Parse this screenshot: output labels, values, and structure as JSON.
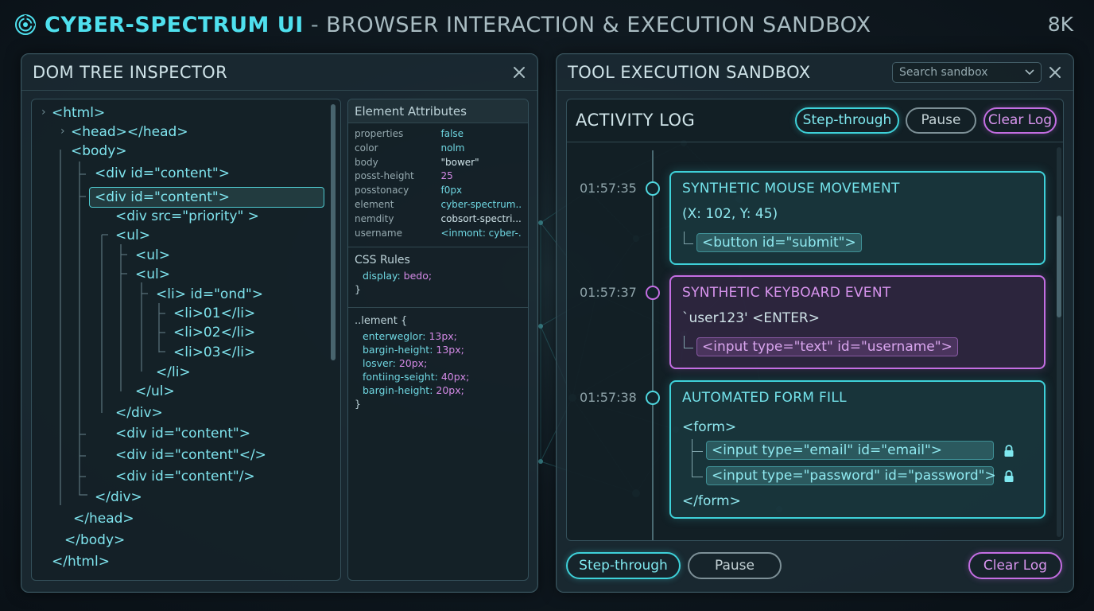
{
  "header": {
    "brand": "CYBER-SPECTRUM UI",
    "separator": " - ",
    "subtitle": "BROWSER INTERACTION & EXECUTION SANDBOX",
    "resolution": "8K"
  },
  "dom_panel": {
    "title": "DOM TREE INSPECTOR",
    "tree": [
      "<html>",
      "<head></head>",
      "<body>",
      "<div id=\"content\">",
      "<div id=\"content\">",
      "<div src=\"priority\" >",
      "<ul>",
      "<ul>",
      "<ul>",
      "<li> id=\"ond\">",
      "<li>01</li>",
      "<li>02</li>",
      "<li>03</li>",
      "</li>",
      "</ul>",
      "</div>",
      "<div id=\"content\">",
      "<div id=\"content\"</>",
      "<div id=\"content\"/>",
      "</div>",
      "</head>",
      "</body>",
      "</html>"
    ],
    "attributes": {
      "title": "Element Attributes",
      "rows": [
        {
          "key": "properties",
          "value": "false"
        },
        {
          "key": "color",
          "value": "nolm"
        },
        {
          "key": "body",
          "value": "\"bower\""
        },
        {
          "key": "posst-height",
          "value": "25"
        },
        {
          "key": "posstonacy",
          "value": "f0px"
        },
        {
          "key": "element",
          "value": "cyber-spectrum..."
        },
        {
          "key": "nemdity",
          "value": "cobsort-spectri..."
        },
        {
          "key": "username",
          "value": "<inmont: cyber-..."
        }
      ]
    },
    "css_rules": {
      "title": "CSS Rules",
      "prop": "display:",
      "value": "bedo;",
      "close": "}"
    },
    "element_rule": {
      "selector": "..lement {",
      "lines": [
        {
          "prop": "enterweglor:",
          "value": "13px;"
        },
        {
          "prop": "bargin-height:",
          "value": "13px;"
        },
        {
          "prop": "losver:",
          "value": "20px;"
        },
        {
          "prop": "fontiing-seight:",
          "value": "40px;"
        },
        {
          "prop": "bargin-height:",
          "value": "20px;"
        }
      ],
      "close": "}"
    }
  },
  "sandbox_panel": {
    "title": "TOOL EXECUTION SANDBOX",
    "search_placeholder": "Search sandbox",
    "activity_log": {
      "title": "ACTIVITY LOG",
      "buttons": {
        "step": "Step-through",
        "pause": "Pause",
        "clear": "Clear Log"
      },
      "events": [
        {
          "time": "01:57:35",
          "title": "SYNTHETIC MOUSE MOVEMENT",
          "detail": "(X: 102, Y: 45)",
          "tag": "<button id=\"submit\">"
        },
        {
          "time": "01:57:37",
          "title": "SYNTHETIC KEYBOARD EVENT",
          "detail": "`user123'  <ENTER>",
          "tag": "<input type=\"text\" id=\"username\">"
        },
        {
          "time": "01:57:38",
          "title": "AUTOMATED FORM FILL",
          "form_open": "<form>",
          "fields": [
            "<input type=\"email\" id=\"email\">",
            "<input type=\"password\" id=\"password\">"
          ],
          "form_close": "</form>"
        }
      ]
    },
    "footer_buttons": {
      "step": "Step-through",
      "pause": "Pause",
      "clear": "Clear Log"
    }
  },
  "colors": {
    "accent_cyan": "#3ed1d9",
    "accent_magenta": "#c46ee3",
    "background": "#0f1a20"
  },
  "icons": [
    "app-logo-icon",
    "close-icon",
    "chevron-down-icon",
    "lock-icon"
  ]
}
